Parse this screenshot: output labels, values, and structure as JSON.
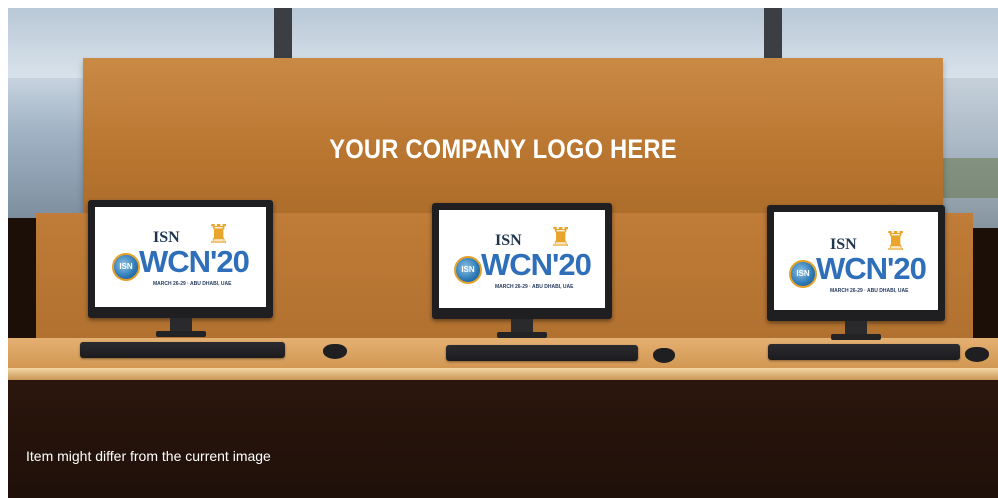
{
  "banner": {
    "logo_placeholder_text": "YOUR COMPANY LOGO HERE"
  },
  "monitors": [
    {
      "org": "ISN",
      "event": "WCN'20",
      "badge": "ISN",
      "dates": "MARCH 26-29 · ABU DHABI, UAE"
    },
    {
      "org": "ISN",
      "event": "WCN'20",
      "badge": "ISN",
      "dates": "MARCH 26-29 · ABU DHABI, UAE"
    },
    {
      "org": "ISN",
      "event": "WCN'20",
      "badge": "ISN",
      "dates": "MARCH 26-29 · ABU DHABI, UAE"
    }
  ],
  "caption": {
    "disclaimer": "Item might differ from the current image"
  }
}
